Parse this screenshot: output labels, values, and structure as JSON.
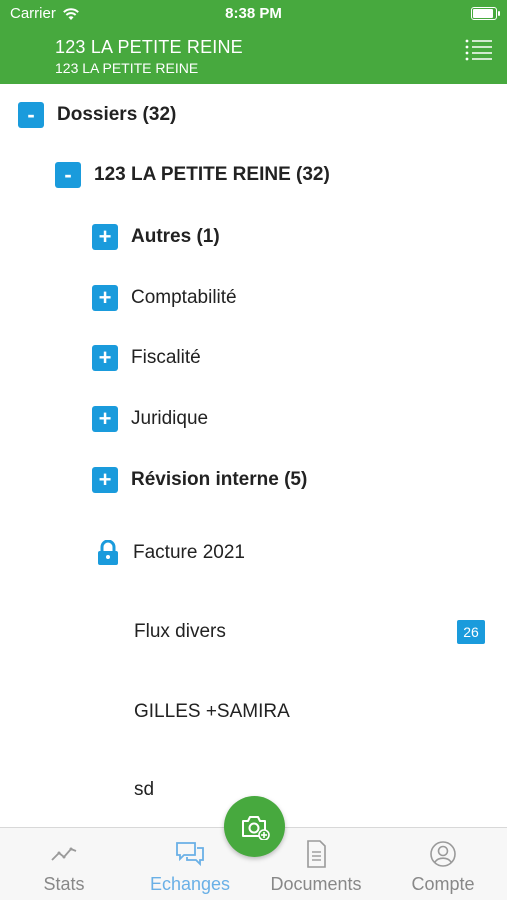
{
  "status_bar": {
    "carrier": "Carrier",
    "time": "8:38 PM"
  },
  "header": {
    "title": "123 LA PETITE REINE",
    "subtitle": "123 LA PETITE REINE"
  },
  "tree": {
    "root": {
      "label": "Dossiers (32)",
      "toggle": "-"
    },
    "company": {
      "label": "123 LA PETITE REINE (32)",
      "toggle": "-"
    },
    "folders": [
      {
        "label": "Autres (1)",
        "toggle": "+"
      },
      {
        "label": "Comptabilité",
        "toggle": "+"
      },
      {
        "label": "Fiscalité",
        "toggle": "+"
      },
      {
        "label": "Juridique",
        "toggle": "+"
      },
      {
        "label": "Révision interne (5)",
        "toggle": "+"
      }
    ],
    "items": [
      {
        "label": "Facture 2021",
        "icon": "lock-icon"
      },
      {
        "label": "Flux divers",
        "badge": "26"
      },
      {
        "label": "GILLES +SAMIRA"
      },
      {
        "label": "sd"
      }
    ]
  },
  "tabbar": {
    "tabs": [
      {
        "label": "Stats",
        "icon": "stats-icon"
      },
      {
        "label": "Echanges",
        "icon": "chat-icon",
        "active": true
      },
      {
        "label": "Documents",
        "icon": "document-icon"
      },
      {
        "label": "Compte",
        "icon": "account-icon"
      }
    ],
    "fab_icon": "camera-add-icon"
  },
  "colors": {
    "header": "#47a93e",
    "accent": "#1a9bdc",
    "active_tab": "#6ab0e6"
  }
}
